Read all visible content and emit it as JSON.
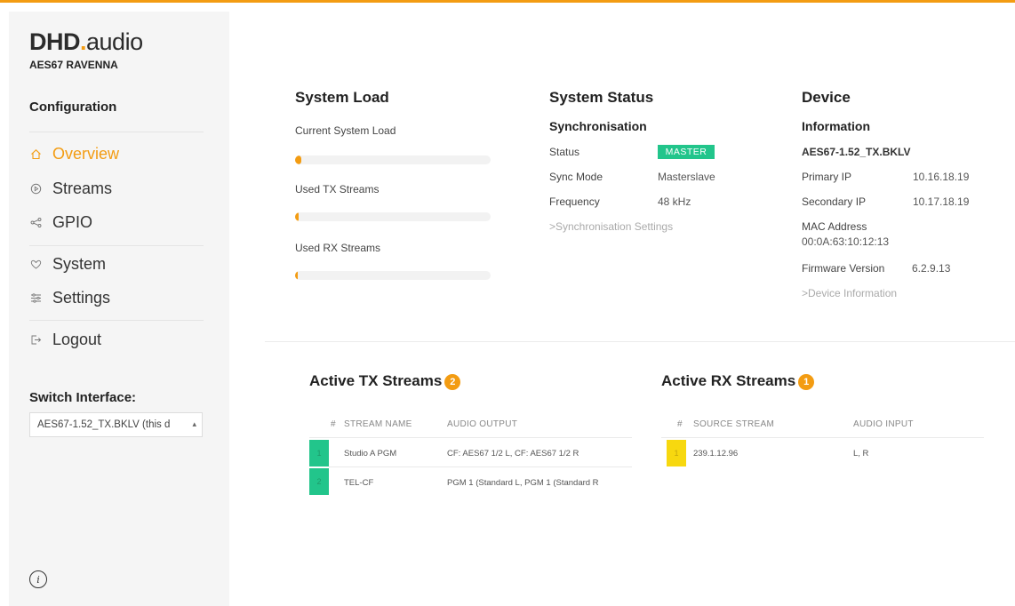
{
  "colors": {
    "accent": "#f39c12",
    "status_ok": "#22c58b",
    "rx_highlight": "#f7d80f"
  },
  "sidebar": {
    "brand_main": "DHD",
    "brand_dot": ".",
    "brand_tail": "audio",
    "brand_sub": "AES67 RAVENNA",
    "section_title": "Configuration",
    "nav": [
      {
        "label": "Overview",
        "icon": "home-icon",
        "active": true
      },
      {
        "label": "Streams",
        "icon": "play-circle-icon"
      },
      {
        "label": "GPIO",
        "icon": "share-icon"
      },
      {
        "label": "System",
        "icon": "heart-icon"
      },
      {
        "label": "Settings",
        "icon": "sliders-icon"
      },
      {
        "label": "Logout",
        "icon": "logout-icon"
      }
    ],
    "switch_title": "Switch Interface:",
    "switch_value": "AES67-1.52_TX.BKLV (this d",
    "info_icon": "info-icon"
  },
  "system_load": {
    "title": "System Load",
    "items": [
      {
        "label": "Current System Load",
        "fraction": 0.03
      },
      {
        "label": "Used TX Streams",
        "fraction": 0.02
      },
      {
        "label": "Used RX Streams",
        "fraction": 0.01
      }
    ]
  },
  "system_status": {
    "title": "System Status",
    "subtitle": "Synchronisation",
    "status_label": "Status",
    "status_value": "MASTER",
    "mode_label": "Sync Mode",
    "mode_value": "Masterslave",
    "freq_label": "Frequency",
    "freq_value": "48 kHz",
    "link": ">Synchronisation Settings"
  },
  "device": {
    "title": "Device",
    "subtitle": "Information",
    "name": "AES67-1.52_TX.BKLV",
    "primary_ip_label": "Primary IP",
    "primary_ip": "10.16.18.19",
    "secondary_ip_label": "Secondary IP",
    "secondary_ip": "10.17.18.19",
    "mac_label": "MAC Address",
    "mac": "00:0A:63:10:12:13",
    "firmware_label": "Firmware Version",
    "firmware": "6.2.9.13",
    "link": ">Device Information"
  },
  "tx_streams": {
    "title": "Active TX Streams",
    "count": "2",
    "columns": [
      "#",
      "STREAM NAME",
      "AUDIO OUTPUT"
    ],
    "rows": [
      {
        "num": "1",
        "name": "Studio A PGM",
        "output": "CF: AES67 1/2 L, CF: AES67 1/2 R"
      },
      {
        "num": "2",
        "name": "TEL-CF",
        "output": "PGM 1 (Standard L, PGM 1 (Standard R"
      }
    ]
  },
  "rx_streams": {
    "title": "Active RX Streams",
    "count": "1",
    "columns": [
      "#",
      "SOURCE STREAM",
      "AUDIO INPUT"
    ],
    "rows": [
      {
        "num": "1",
        "source": "239.1.12.96",
        "input": "L, R"
      }
    ]
  }
}
